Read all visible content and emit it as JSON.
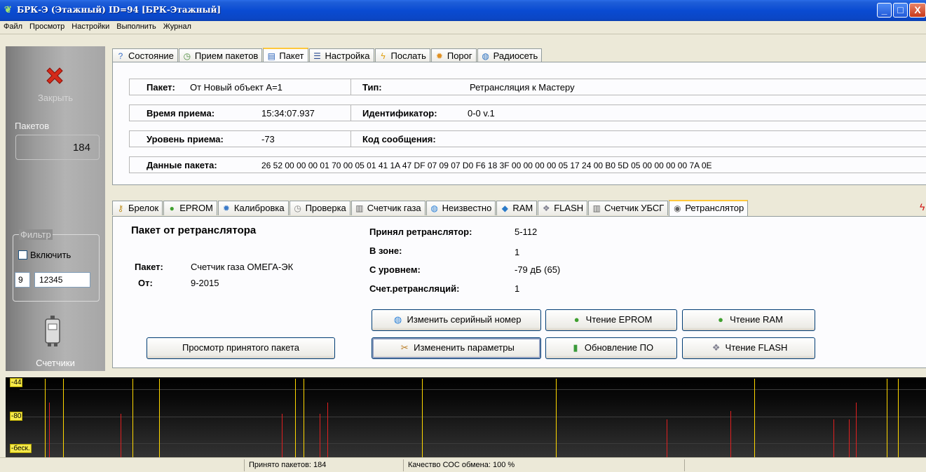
{
  "window": {
    "title": "БРК-Э (Этажный) ID=94 [БРК-Этажный]",
    "controls": {
      "minimize": "_",
      "maximize": "□",
      "close": "X"
    }
  },
  "menu": [
    "Файл",
    "Просмотр",
    "Настройки",
    "Выполнить",
    "Журнал"
  ],
  "sidebar": {
    "close_label": "Закрыть",
    "packets_label": "Пакетов",
    "packets_count": "184",
    "filter": {
      "title": "Фильтр",
      "enable_label": "Включить",
      "enabled": false,
      "value_a": "9",
      "value_b": "12345"
    },
    "meters_label": "Счетчики"
  },
  "main_tabs": [
    {
      "label": "Состояние",
      "icon": "help-icon",
      "glyph": "?",
      "color": "#3b6fc8",
      "active": false
    },
    {
      "label": "Прием пакетов",
      "icon": "clock-icon",
      "glyph": "◷",
      "color": "#4a8a3a",
      "active": false
    },
    {
      "label": "Пакет",
      "icon": "book-icon",
      "glyph": "▤",
      "color": "#2a62b8",
      "active": true
    },
    {
      "label": "Настройка",
      "icon": "list-icon",
      "glyph": "☰",
      "color": "#2a4a90",
      "active": false
    },
    {
      "label": "Послать",
      "icon": "lightning-icon",
      "glyph": "ϟ",
      "color": "#e0a010",
      "active": false
    },
    {
      "label": "Порог",
      "icon": "gear-icon",
      "glyph": "✹",
      "color": "#e09020",
      "active": false
    },
    {
      "label": "Радиосеть",
      "icon": "globe-icon",
      "glyph": "◍",
      "color": "#2a70c0",
      "active": false
    }
  ],
  "packet_info": {
    "packet_label": "Пакет:",
    "packet_value": "От Новый объект A=1",
    "type_label": "Тип:",
    "type_value": "Ретрансляция к Мастеру",
    "time_label": "Время приема:",
    "time_value": "15:34:07.937",
    "id_label": "Идентификатор:",
    "id_value": "0-0 v.1",
    "level_label": "Уровень приема:",
    "level_value": "-73",
    "code_label": "Код сообщения:",
    "code_value": "",
    "data_label": "Данные пакета:",
    "data_value": "26 52 00 00 00 01 70 00 05 01 41 1A 47 DF 07 09 07 D0 F6 18 3F 00 00 00 00 05 17 24 00 B0 5D 05 00 00 00 00 7A 0E"
  },
  "sub_tabs": [
    {
      "label": "Брелок",
      "icon": "key-icon",
      "glyph": "⚷",
      "color": "#c09020",
      "active": false
    },
    {
      "label": "EPROM",
      "icon": "eprom-icon",
      "glyph": "●",
      "color": "#40a030",
      "active": false
    },
    {
      "label": "Калибровка",
      "icon": "gear-icon",
      "glyph": "✹",
      "color": "#3a7ac8",
      "active": false
    },
    {
      "label": "Проверка",
      "icon": "clock-icon",
      "glyph": "◷",
      "color": "#808080",
      "active": false
    },
    {
      "label": "Счетчик газа",
      "icon": "meter-icon",
      "glyph": "▥",
      "color": "#606060",
      "active": false
    },
    {
      "label": "Неизвестно",
      "icon": "globe-icon",
      "glyph": "◍",
      "color": "#2a80d8",
      "active": false
    },
    {
      "label": "RAM",
      "icon": "diamond-icon",
      "glyph": "◆",
      "color": "#2a7ac8",
      "active": false
    },
    {
      "label": "FLASH",
      "icon": "flash-icon",
      "glyph": "❖",
      "color": "#808090",
      "active": false
    },
    {
      "label": "Счетчик УБСГ",
      "icon": "meter-icon",
      "glyph": "▥",
      "color": "#606060",
      "active": false
    },
    {
      "label": "Ретранслятор",
      "icon": "antenna-icon",
      "glyph": "◉",
      "color": "#606060",
      "active": true
    }
  ],
  "relay": {
    "heading": "Пакет от ретранслятора",
    "packet_label": "Пакет:",
    "packet_value": "Счетчик газа ОМЕГА-ЭК",
    "from_label": "От:",
    "from_value": "9-2015",
    "received_label": "Принял ретранслятор:",
    "received_value": "5-112",
    "zone_label": "В зоне:",
    "zone_value": "1",
    "level_label": "С уровнем:",
    "level_value": "-79 дБ (65)",
    "count_label": "Счет.ретрансляций:",
    "count_value": "1"
  },
  "buttons": {
    "view_packet": "Просмотр принятого пакета",
    "change_serial": "Изменить серийный номер",
    "read_eprom": "Чтение EPROM",
    "read_ram": "Чтение RAM",
    "change_params": "Измененить параметры",
    "update_fw": "Обновление ПО",
    "read_flash": "Чтение FLASH"
  },
  "graph": {
    "labels": [
      "-44",
      "-80",
      "-беск."
    ],
    "yellow_color": "#ffd800",
    "red_color": "#e02020"
  },
  "status": {
    "received": "Принято пакетов: 184",
    "quality": "Качество СОС обмена: 100 %"
  }
}
